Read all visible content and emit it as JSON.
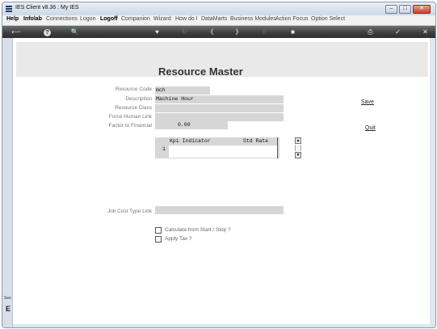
{
  "window": {
    "title": "IES Client v8.36 : My IES",
    "controls": [
      "–",
      "□",
      "✕"
    ]
  },
  "menu": [
    "Help",
    "Infolab",
    "Connections",
    "Logon",
    "Logoff",
    "Companion",
    "Wizard",
    "How do I",
    "DataMarts",
    "Business Modules",
    "Action Focus",
    "Option Select"
  ],
  "toolbar": {
    "back": "⟵",
    "help": "?",
    "search": "🔍",
    "heart": "♥",
    "refresh": "↻",
    "prev": "《",
    "next": "》",
    "mark": "⇧",
    "stop": "■",
    "print": "⎙",
    "ok": "✓",
    "exit": "✕"
  },
  "left_strip": {
    "label": "Ses",
    "glyph": "E"
  },
  "page": {
    "title": "Resource Master"
  },
  "form": {
    "resource_code": {
      "label": "Resource Code",
      "value": "mch"
    },
    "description": {
      "label": "Description",
      "value": "Machine Hour"
    },
    "resource_class": {
      "label": "Resource Class",
      "value": ""
    },
    "force_human_link": {
      "label": "Force Human Link",
      "value": ""
    },
    "factor_to_financial": {
      "label": "Factor to Financial",
      "value": "0.00"
    },
    "job_cost_type_link": {
      "label": "Job Cost Type Link",
      "value": ""
    }
  },
  "grid": {
    "columns": [
      "Kpi Indicator",
      "Std Rate"
    ],
    "rows": [
      {
        "num": "1",
        "kpi": "",
        "rate": ""
      }
    ]
  },
  "actions": {
    "save": "Save",
    "quit": "Quit"
  },
  "checks": [
    {
      "label": "Calculate from Start / Stop ?",
      "checked": false
    },
    {
      "label": "Apply Tax ?",
      "checked": false
    }
  ]
}
